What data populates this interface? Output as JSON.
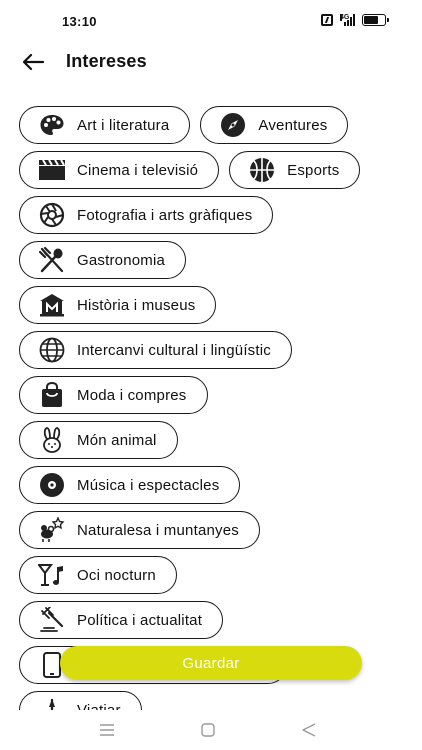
{
  "status_bar": {
    "time": "13:10",
    "signal_label": "4G",
    "icons": [
      "nfc-icon",
      "signal-icon",
      "battery-icon"
    ]
  },
  "header": {
    "back_icon": "arrow-left-icon",
    "title": "Intereses"
  },
  "interests": [
    {
      "label": "Art i literatura",
      "icon": "palette-icon"
    },
    {
      "label": "Aventures",
      "icon": "compass-icon"
    },
    {
      "label": "Cinema i televisió",
      "icon": "clapperboard-icon"
    },
    {
      "label": "Esports",
      "icon": "basketball-icon"
    },
    {
      "label": "Fotografia i arts gràfiques",
      "icon": "camera-aperture-icon"
    },
    {
      "label": "Gastronomia",
      "icon": "utensils-icon"
    },
    {
      "label": "Història i museus",
      "icon": "museum-icon"
    },
    {
      "label": "Intercanvi cultural i lingüístic",
      "icon": "globe-icon"
    },
    {
      "label": "Moda i compres",
      "icon": "shopping-bag-icon"
    },
    {
      "label": "Món animal",
      "icon": "rabbit-icon"
    },
    {
      "label": "Música i espectacles",
      "icon": "vinyl-record-icon"
    },
    {
      "label": "Naturalesa i muntanyes",
      "icon": "nature-icon"
    },
    {
      "label": "Oci nocturn",
      "icon": "cocktail-music-icon"
    },
    {
      "label": "Política i actualitat",
      "icon": "gavel-icon"
    },
    {
      "label": "",
      "icon": "smartphone-icon"
    },
    {
      "label": "Viatjar",
      "icon": "travel-icon"
    }
  ],
  "save_button": {
    "label": "Guardar"
  },
  "colors": {
    "accent": "#d8dc0e",
    "chip_border": "#1a1a1a",
    "text": "#111111"
  },
  "navigation_bar": {
    "icons": [
      "menu-icon",
      "home-square-icon",
      "back-triangle-icon"
    ]
  }
}
